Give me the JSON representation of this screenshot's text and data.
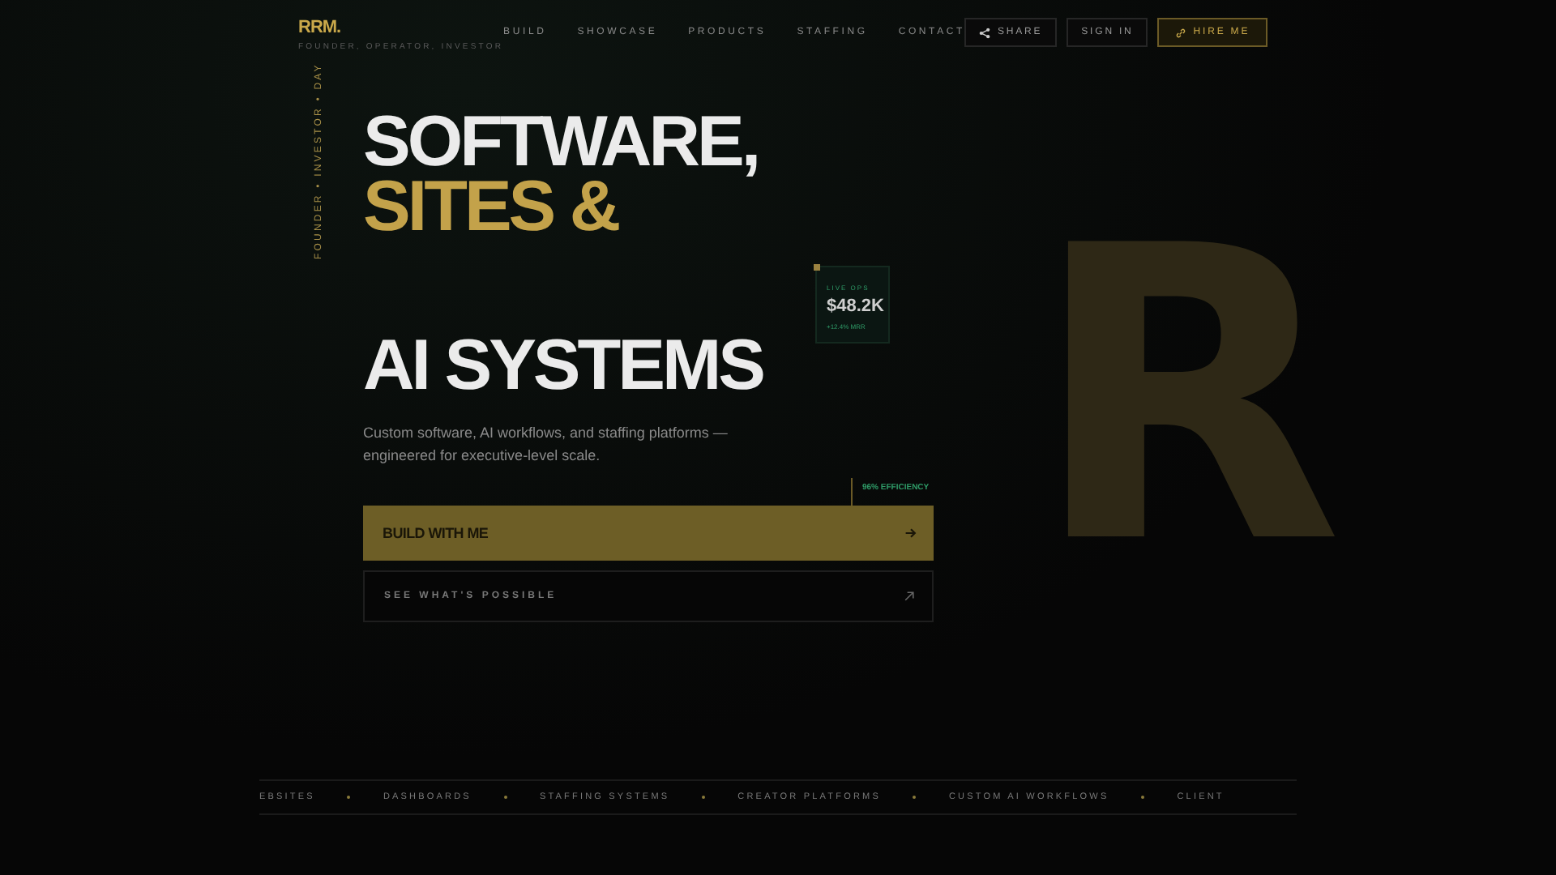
{
  "brand": {
    "logo": "RRM.",
    "tagline": "FOUNDER, OPERATOR, INVESTOR"
  },
  "side_label": "FOUNDER • INVESTOR • DAY",
  "nav": [
    {
      "label": "BUILD"
    },
    {
      "label": "SHOWCASE"
    },
    {
      "label": "PRODUCTS"
    },
    {
      "label": "STAFFING"
    },
    {
      "label": "CONTACT"
    }
  ],
  "actions": [
    {
      "kind": "share",
      "label": "SHARE"
    },
    {
      "kind": "plain",
      "label": "SIGN IN"
    },
    {
      "kind": "primary",
      "label": "HIRE ME"
    }
  ],
  "headline": [
    {
      "text": "SOFTWARE,",
      "accent": false
    },
    {
      "text": "SITES &",
      "accent": true
    },
    {
      "text": "AI SYSTEMS",
      "accent": false
    }
  ],
  "stat_card": {
    "label": "LIVE OPS",
    "value": "$48.2K",
    "change": "+12.4% MRR"
  },
  "subtitle": "Custom software, AI workflows, and staffing platforms — engineered for executive-level scale.",
  "efficiency_badge": "96% EFFICIENCY",
  "buttons": [
    {
      "kind": "primary",
      "label": "BUILD WITH ME"
    },
    {
      "kind": "outline",
      "label": "SEE WHAT'S POSSIBLE"
    }
  ],
  "backdrop_letter": "R",
  "ticker": [
    "EBSITES",
    "DASHBOARDS",
    "STAFFING SYSTEMS",
    "CREATOR PLATFORMS",
    "CUSTOM AI WORKFLOWS",
    "CLIENT"
  ]
}
